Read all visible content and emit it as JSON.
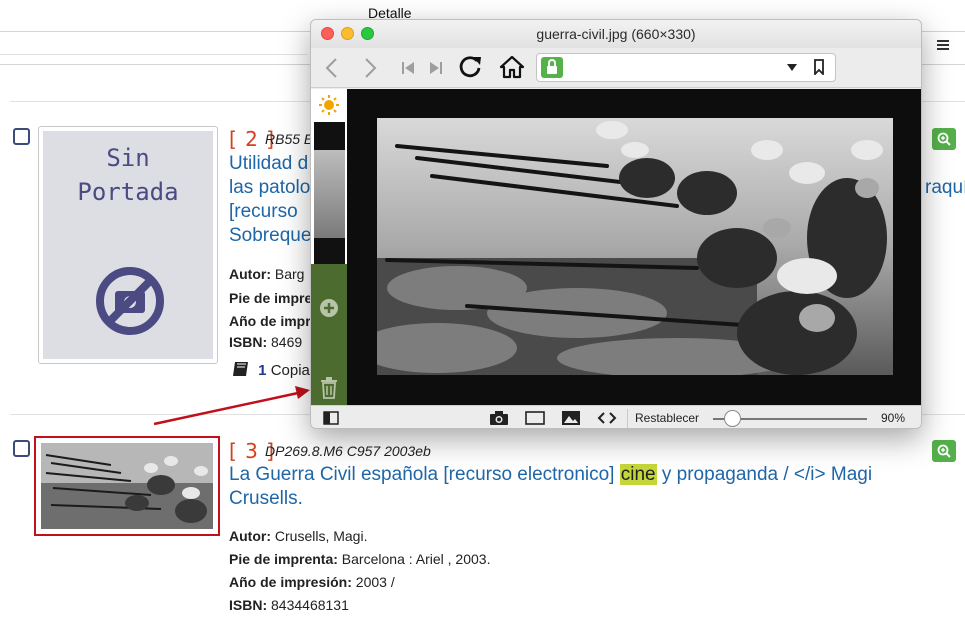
{
  "window_label": "Detalle",
  "records": [
    {
      "number": "[ 2 ]",
      "call_number": "RB55 E",
      "cover_text_line1": "Sin",
      "cover_text_line2": "Portada",
      "title_lines": [
        "Utilidad d",
        "las patolo",
        "[recurso",
        "Sobreque"
      ],
      "title_right_fragment": "raquí",
      "fields": [
        {
          "label": "Autor:",
          "value": " Barg"
        },
        {
          "label": "Pie de impre",
          "value": ""
        },
        {
          "label": "Año de impre",
          "value": ""
        },
        {
          "label": "ISBN:",
          "value": " 8469"
        }
      ],
      "copies_count": "1",
      "copies_label": "Copia"
    },
    {
      "number": "[ 3 ]",
      "call_number": "DP269.8.M6 C957 2003eb",
      "title_part1": "La Guerra Civil española [recurso electronico] ",
      "title_highlight": "cine",
      "title_part2": " y propaganda / </i> Magi",
      "title_line2": "Crusells.",
      "fields": [
        {
          "label": "Autor:",
          "value": " Crusells, Magi."
        },
        {
          "label": "Pie de imprenta:",
          "value": " Barcelona : Ariel , 2003."
        },
        {
          "label": "Año de impresión:",
          "value": " 2003 /"
        },
        {
          "label": "ISBN:",
          "value": " 8434468131"
        }
      ]
    }
  ],
  "popup": {
    "title": "guerra-civil.jpg (660×330)",
    "restablecer": "Restablecer",
    "zoom_percent": "90%",
    "zoom_level": 0.1
  },
  "colors": {
    "link": "#1e66a8",
    "record_number": "#d2401c",
    "highlight": "#c5d63a",
    "zoom_button": "#54b04a",
    "sidebar": "#4c6b2f",
    "arrow": "#c0101b"
  }
}
